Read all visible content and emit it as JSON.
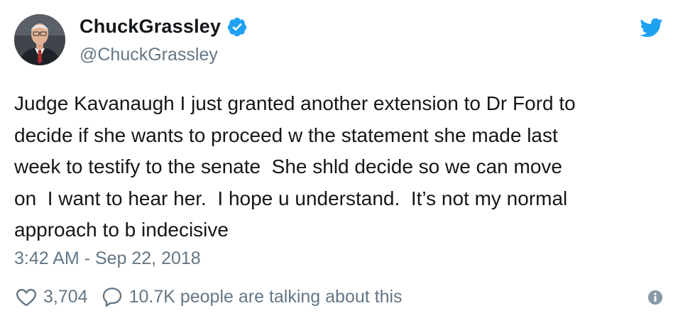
{
  "user": {
    "display_name": "ChuckGrassley",
    "handle": "@ChuckGrassley",
    "verified": true,
    "avatar_icon": "profile-photo-icon"
  },
  "tweet": {
    "text": "Judge Kavanaugh I just granted another extension to Dr Ford to\ndecide if she wants to proceed w the statement she made last\nweek to testify to the senate  She shld decide so we can move\non  I want to hear her.  I hope u understand.  It’s not my normal\napproach to b indecisive",
    "timestamp": "3:42 AM - Sep 22, 2018"
  },
  "actions": {
    "like_icon": "heart-icon",
    "like_count": "3,704",
    "reply_icon": "speech-bubble-icon",
    "talking_text": "10.7K people are talking about this",
    "info_icon": "info-icon"
  },
  "colors": {
    "brand_blue": "#1da1f2",
    "text_primary": "#14171a",
    "text_secondary": "#657786"
  }
}
